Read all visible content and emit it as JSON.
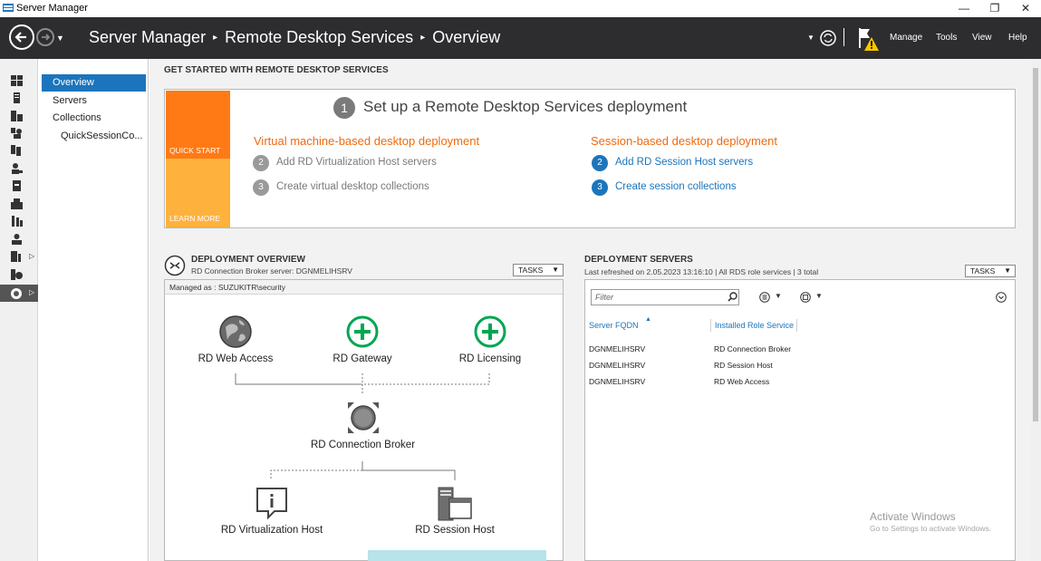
{
  "window": {
    "title": "Server Manager",
    "minimize": "—",
    "restore": "❐",
    "close": "✕"
  },
  "header": {
    "breadcrumbs": [
      "Server Manager",
      "Remote Desktop Services",
      "Overview"
    ],
    "menu": {
      "manage": "Manage",
      "tools": "Tools",
      "view": "View",
      "help": "Help"
    }
  },
  "nav": {
    "items": [
      {
        "label": "Overview",
        "selected": true
      },
      {
        "label": "Servers",
        "selected": false
      },
      {
        "label": "Collections",
        "selected": false
      },
      {
        "label": "QuickSessionCo...",
        "selected": false
      }
    ]
  },
  "get_started": {
    "heading": "GET STARTED WITH REMOTE DESKTOP SERVICES",
    "quick_start": "QUICK START",
    "learn_more": "LEARN MORE",
    "step1_num": "1",
    "step1_title": "Set up a Remote Desktop Services deployment",
    "vm_heading": "Virtual machine-based desktop deployment",
    "vm_steps": [
      {
        "num": "2",
        "text": "Add RD Virtualization Host servers"
      },
      {
        "num": "3",
        "text": "Create virtual desktop collections"
      }
    ],
    "session_heading": "Session-based desktop deployment",
    "session_steps": [
      {
        "num": "2",
        "text": "Add RD Session Host servers"
      },
      {
        "num": "3",
        "text": "Create session collections"
      }
    ]
  },
  "deployment_overview": {
    "heading": "DEPLOYMENT OVERVIEW",
    "broker_server": "RD Connection Broker server: DGNMELIHSRV",
    "tasks": "TASKS",
    "managed_as": "Managed as : SUZUKITR\\security",
    "nodes": {
      "web_access": "RD Web Access",
      "gateway": "RD Gateway",
      "licensing": "RD Licensing",
      "broker": "RD Connection Broker",
      "virtualization": "RD Virtualization Host",
      "session_host": "RD Session Host"
    }
  },
  "deployment_servers": {
    "heading": "DEPLOYMENT SERVERS",
    "subtitle": "Last refreshed on 2.05.2023 13:16:10 | All RDS role services  | 3 total",
    "tasks": "TASKS",
    "filter_placeholder": "Filter",
    "columns": [
      "Server FQDN",
      "Installed Role Service"
    ],
    "rows": [
      [
        "DGNMELIHSRV",
        "RD Connection Broker"
      ],
      [
        "DGNMELIHSRV",
        "RD Session Host"
      ],
      [
        "DGNMELIHSRV",
        "RD Web Access"
      ]
    ]
  },
  "watermark": {
    "line1": "Activate Windows",
    "line2": "Go to Settings to activate Windows."
  },
  "colors": {
    "header": "#2d2d30",
    "accent": "#1c75bc",
    "orange": "#ff7a14",
    "orange_light": "#ffb13d",
    "green": "#00a651"
  }
}
